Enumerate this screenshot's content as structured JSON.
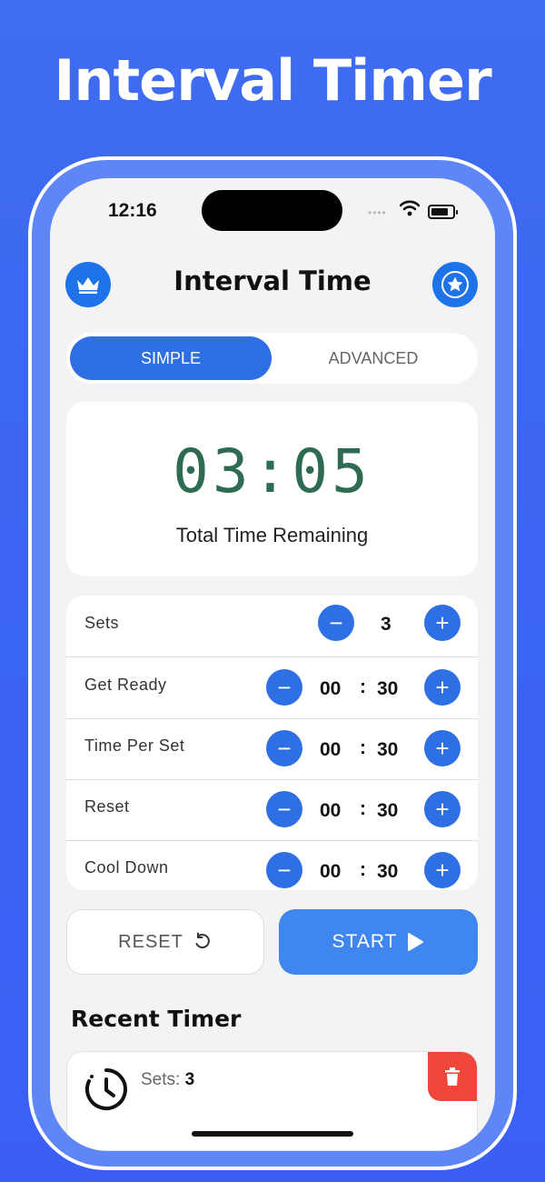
{
  "headline": "Interval Timer",
  "status_bar": {
    "time": "12:16",
    "dots": "••••"
  },
  "header": {
    "title": "Interval Time",
    "left_icon": "crown-icon",
    "right_icon": "star-icon"
  },
  "tabs": [
    {
      "label": "SIMPLE",
      "selected": true
    },
    {
      "label": "ADVANCED",
      "selected": false
    }
  ],
  "display": {
    "time": "03:05",
    "caption": "Total Time Remaining"
  },
  "settings": [
    {
      "label": "Sets",
      "value": "3"
    },
    {
      "label": "Get Ready",
      "min": "00",
      "sec": "30"
    },
    {
      "label": "Time Per Set",
      "min": "00",
      "sec": "30"
    },
    {
      "label": "Reset",
      "min": "00",
      "sec": "30"
    },
    {
      "label": "Cool Down",
      "min": "00",
      "sec": "30"
    }
  ],
  "controls": {
    "minus": "−",
    "plus": "+",
    "colon": ":"
  },
  "buttons": {
    "reset": "RESET",
    "start": "START"
  },
  "recent": {
    "title": "Recent Timer",
    "sets_label": "Sets:",
    "sets_value": "3"
  },
  "colors": {
    "accent": "#2f6fe4",
    "timer": "#2f6b52",
    "delete": "#f0453a"
  }
}
